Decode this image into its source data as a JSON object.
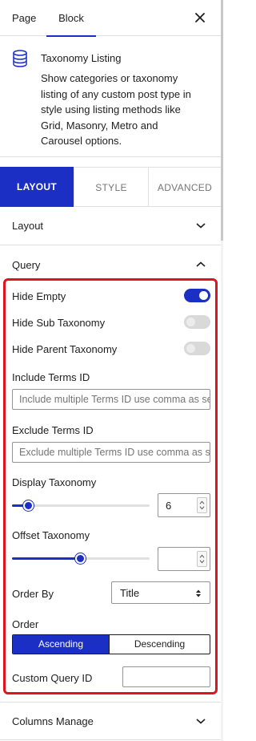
{
  "header": {
    "tabs": [
      "Page",
      "Block"
    ],
    "active_tab": "Block",
    "close_icon": "close-icon"
  },
  "block": {
    "icon": "database-icon",
    "title": "Taxonomy Listing",
    "description": "Show categories or taxonomy listing of any custom post type in style using listing methods like Grid, Masonry, Metro and Carousel options."
  },
  "main_tabs": {
    "layout": "LAYOUT",
    "style": "STYLE",
    "advanced": "ADVANCED",
    "active": "LAYOUT"
  },
  "panels": {
    "layout": "Layout",
    "query": "Query",
    "columns": "Columns Manage"
  },
  "query": {
    "hide_empty": {
      "label": "Hide Empty",
      "value": true
    },
    "hide_sub": {
      "label": "Hide Sub Taxonomy",
      "value": false
    },
    "hide_parent": {
      "label": "Hide Parent Taxonomy",
      "value": false
    },
    "include_terms": {
      "label": "Include Terms ID",
      "placeholder": "Include multiple Terms ID use comma as separator",
      "value": ""
    },
    "exclude_terms": {
      "label": "Exclude Terms ID",
      "placeholder": "Exclude multiple Terms ID use comma as separator",
      "value": ""
    },
    "display_taxonomy": {
      "label": "Display Taxonomy",
      "value": "6",
      "slider_fraction": 0.12
    },
    "offset_taxonomy": {
      "label": "Offset Taxonomy",
      "value": "",
      "slider_fraction": 0.5
    },
    "order_by": {
      "label": "Order By",
      "value": "Title"
    },
    "order": {
      "label": "Order",
      "options": [
        "Ascending",
        "Descending"
      ],
      "selected": "Ascending"
    },
    "custom_query_id": {
      "label": "Custom Query ID",
      "value": ""
    }
  },
  "colors": {
    "accent": "#1c2fc4",
    "highlight": "#e0141c"
  }
}
